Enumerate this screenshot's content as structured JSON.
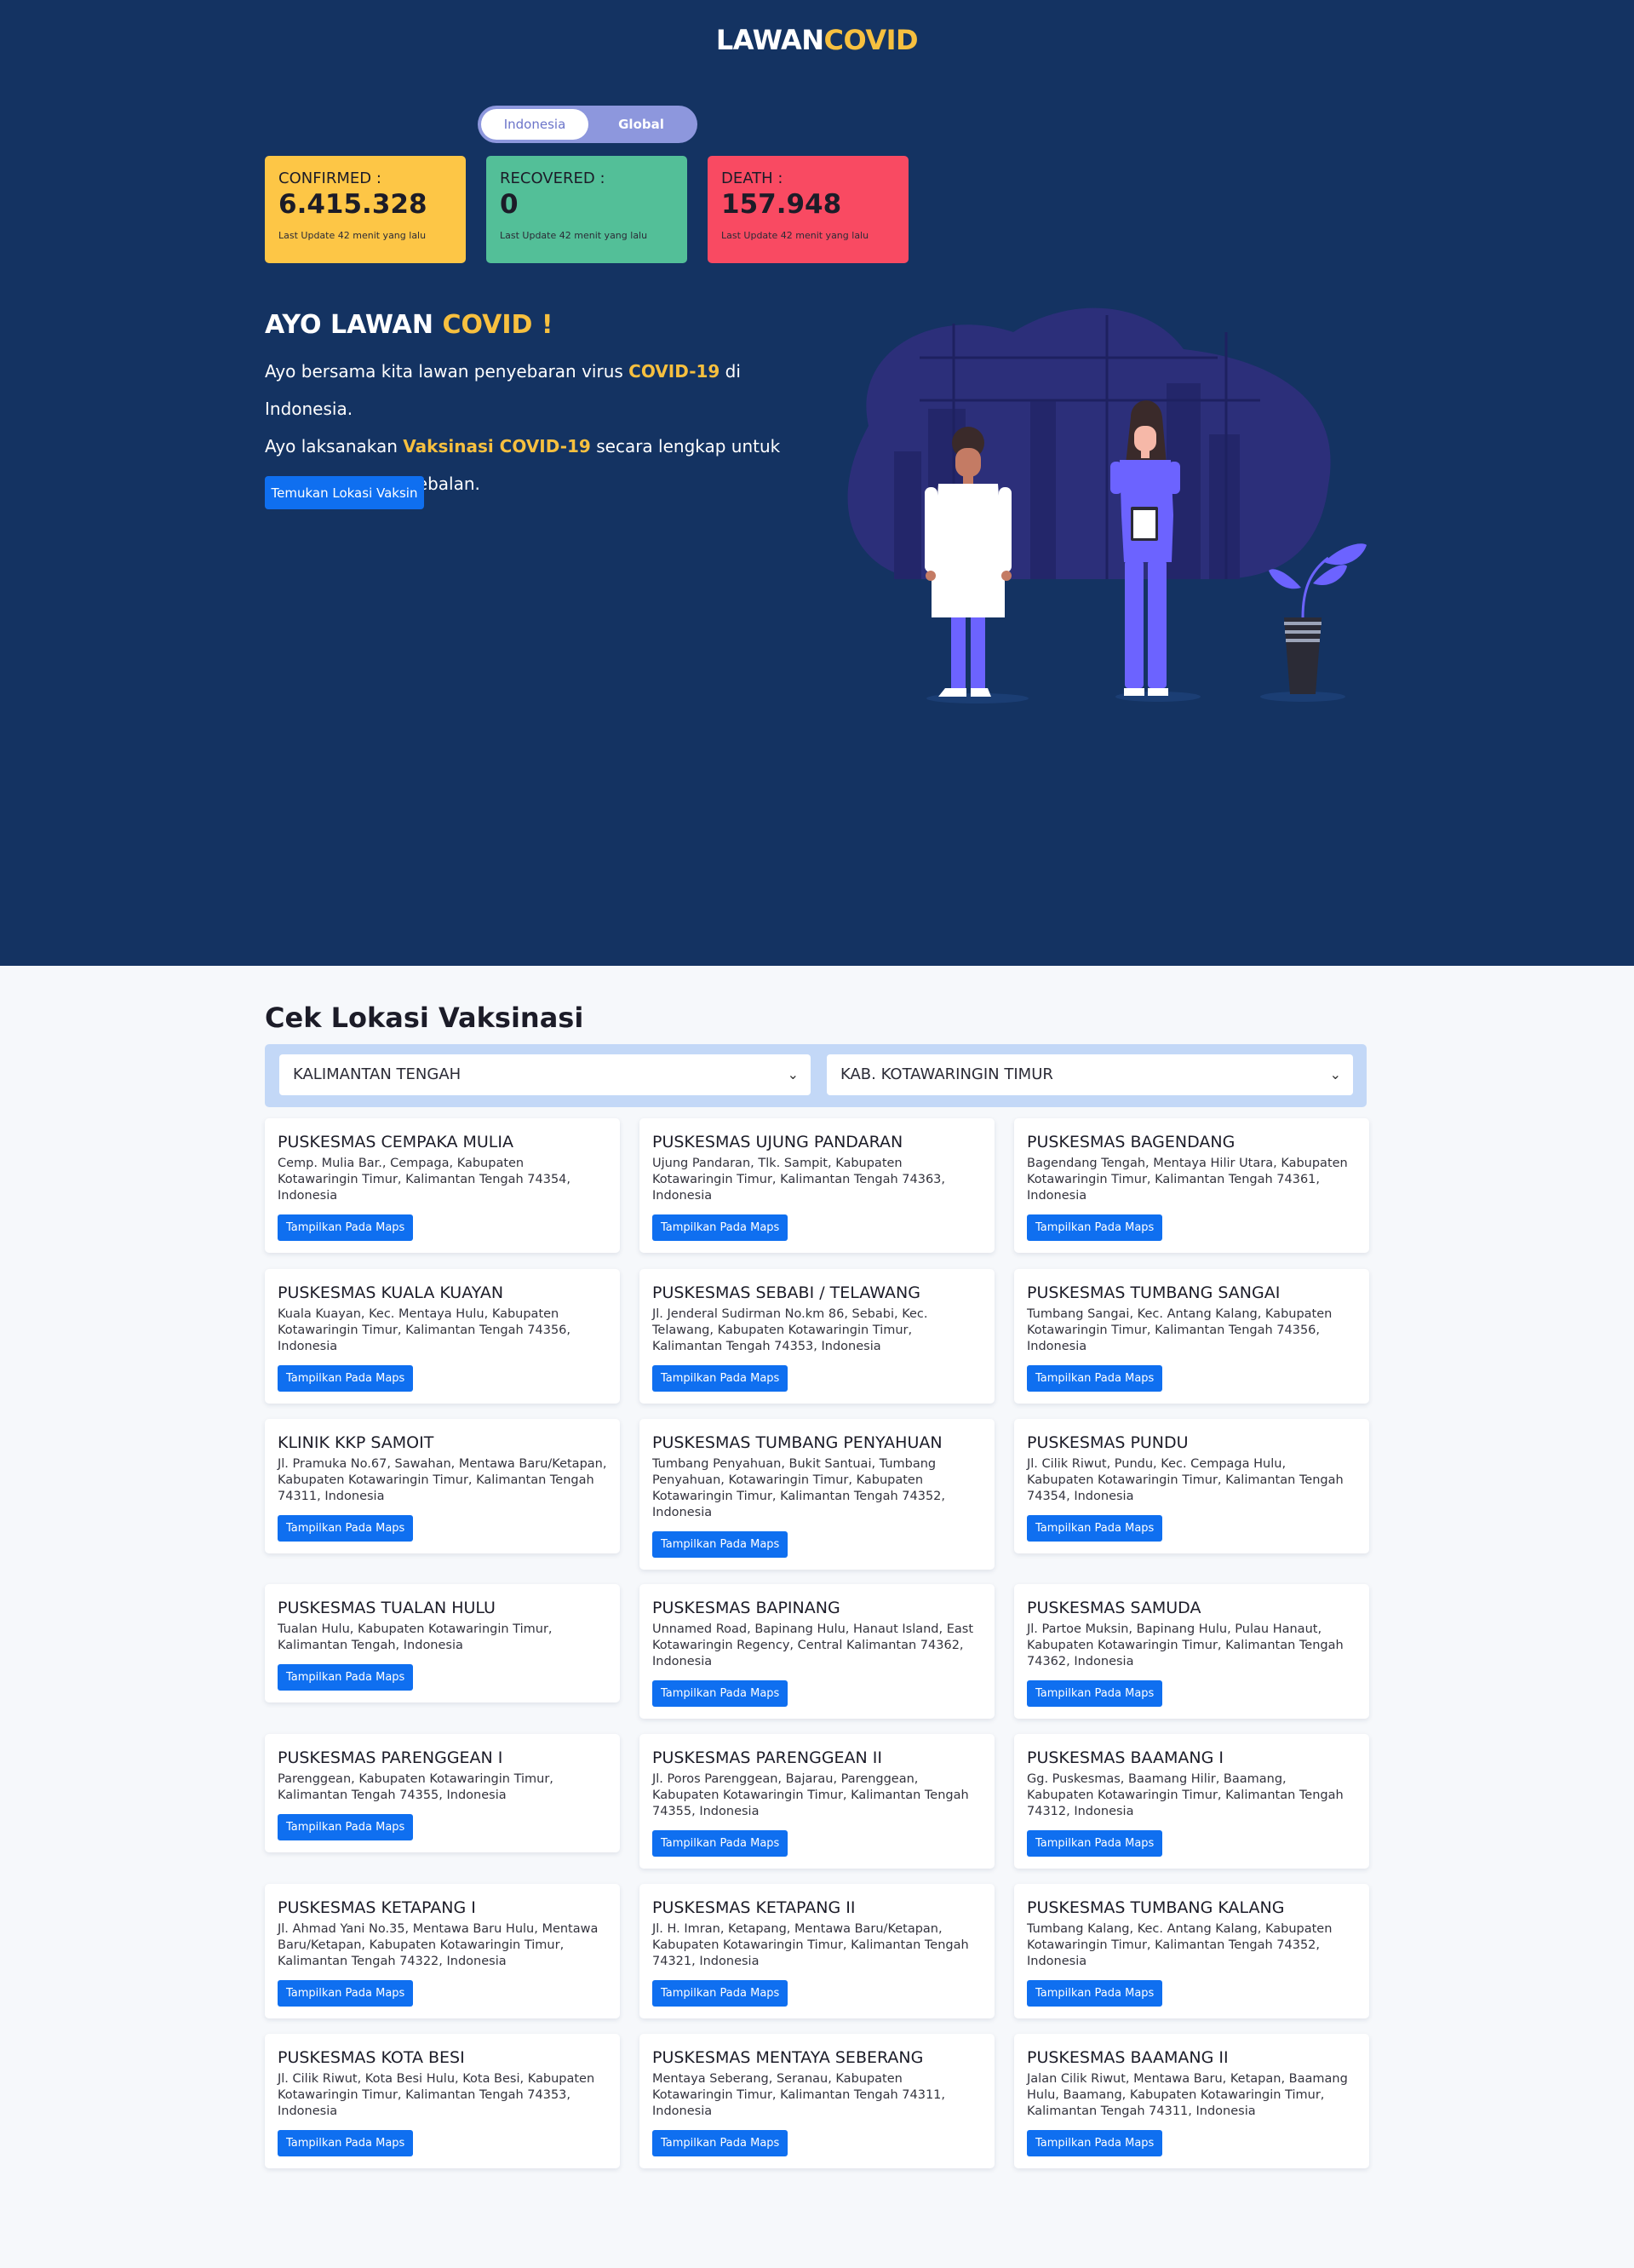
{
  "brand": {
    "part1": "LAWAN",
    "part2": "COVID"
  },
  "toggle": {
    "option_active": "Indonesia",
    "option_inactive": "Global"
  },
  "stats": {
    "confirmed": {
      "label": "CONFIRMED :",
      "value": "6.415.328",
      "update": "Last Update 42 menit yang lalu"
    },
    "recovered": {
      "label": "RECOVERED :",
      "value": "0",
      "update": "Last Update 42 menit yang lalu"
    },
    "death": {
      "label": "DEATH :",
      "value": "157.948",
      "update": "Last Update 42 menit yang lalu"
    }
  },
  "hero": {
    "headline_a": "AYO LAWAN ",
    "headline_b": "COVID !",
    "line1_a": "Ayo bersama kita lawan penyebaran virus ",
    "line1_b": "COVID-19",
    "line1_c": " di Indonesia.",
    "line2_a": "Ayo laksanakan ",
    "line2_b": "Vaksinasi COVID-19",
    "line2_c": " secara lengkap untuk mendapatkan kekebalan.",
    "cta_label": "Temukan Lokasi Vaksin"
  },
  "locations": {
    "title": "Cek Lokasi Vaksinasi",
    "province": "KALIMANTAN TENGAH",
    "regency": "KAB. KOTAWARINGIN TIMUR",
    "button_label": "Tampilkan Pada Maps",
    "items": [
      {
        "name": "PUSKESMAS CEMPAKA MULIA",
        "address": "Cemp. Mulia Bar., Cempaga, Kabupaten Kotawaringin Timur, Kalimantan Tengah 74354, Indonesia"
      },
      {
        "name": "PUSKESMAS UJUNG PANDARAN",
        "address": "Ujung Pandaran, Tlk. Sampit, Kabupaten Kotawaringin Timur, Kalimantan Tengah 74363, Indonesia"
      },
      {
        "name": "PUSKESMAS BAGENDANG",
        "address": "Bagendang Tengah, Mentaya Hilir Utara, Kabupaten Kotawaringin Timur, Kalimantan Tengah 74361, Indonesia"
      },
      {
        "name": "PUSKESMAS KUALA KUAYAN",
        "address": "Kuala Kuayan, Kec. Mentaya Hulu, Kabupaten Kotawaringin Timur, Kalimantan Tengah 74356, Indonesia"
      },
      {
        "name": "PUSKESMAS SEBABI / TELAWANG",
        "address": "Jl. Jenderal Sudirman No.km 86, Sebabi, Kec. Telawang, Kabupaten Kotawaringin Timur, Kalimantan Tengah 74353, Indonesia"
      },
      {
        "name": "PUSKESMAS TUMBANG SANGAI",
        "address": "Tumbang Sangai, Kec. Antang Kalang, Kabupaten Kotawaringin Timur, Kalimantan Tengah 74356, Indonesia"
      },
      {
        "name": "KLINIK KKP SAMOIT",
        "address": "Jl. Pramuka No.67, Sawahan, Mentawa Baru/Ketapan, Kabupaten Kotawaringin Timur, Kalimantan Tengah 74311, Indonesia"
      },
      {
        "name": "PUSKESMAS TUMBANG PENYAHUAN",
        "address": "Tumbang Penyahuan, Bukit Santuai, Tumbang Penyahuan, Kotawaringin Timur, Kabupaten Kotawaringin Timur, Kalimantan Tengah 74352, Indonesia"
      },
      {
        "name": "PUSKESMAS PUNDU",
        "address": "Jl. Cilik Riwut, Pundu, Kec. Cempaga Hulu, Kabupaten Kotawaringin Timur, Kalimantan Tengah 74354, Indonesia"
      },
      {
        "name": "PUSKESMAS TUALAN HULU",
        "address": "Tualan Hulu, Kabupaten Kotawaringin Timur, Kalimantan Tengah, Indonesia"
      },
      {
        "name": "PUSKESMAS BAPINANG",
        "address": "Unnamed Road, Bapinang Hulu, Hanaut Island, East Kotawaringin Regency, Central Kalimantan 74362, Indonesia"
      },
      {
        "name": "PUSKESMAS SAMUDA",
        "address": "Jl. Partoe Muksin, Bapinang Hulu, Pulau Hanaut, Kabupaten Kotawaringin Timur, Kalimantan Tengah 74362, Indonesia"
      },
      {
        "name": "PUSKESMAS PARENGGEAN I",
        "address": "Parenggean, Kabupaten Kotawaringin Timur, Kalimantan Tengah 74355, Indonesia"
      },
      {
        "name": "PUSKESMAS PARENGGEAN II",
        "address": "Jl. Poros Parenggean, Bajarau, Parenggean, Kabupaten Kotawaringin Timur, Kalimantan Tengah 74355, Indonesia"
      },
      {
        "name": "PUSKESMAS BAAMANG I",
        "address": "Gg. Puskesmas, Baamang Hilir, Baamang, Kabupaten Kotawaringin Timur, Kalimantan Tengah 74312, Indonesia"
      },
      {
        "name": "PUSKESMAS KETAPANG I",
        "address": "Jl. Ahmad Yani No.35, Mentawa Baru Hulu, Mentawa Baru/Ketapan, Kabupaten Kotawaringin Timur, Kalimantan Tengah 74322, Indonesia"
      },
      {
        "name": "PUSKESMAS KETAPANG II",
        "address": "Jl. H. Imran, Ketapang, Mentawa Baru/Ketapan, Kabupaten Kotawaringin Timur, Kalimantan Tengah 74321, Indonesia"
      },
      {
        "name": "PUSKESMAS TUMBANG KALANG",
        "address": "Tumbang Kalang, Kec. Antang Kalang, Kabupaten Kotawaringin Timur, Kalimantan Tengah 74352, Indonesia"
      },
      {
        "name": "PUSKESMAS KOTA BESI",
        "address": "Jl. Cilik Riwut, Kota Besi Hulu, Kota Besi, Kabupaten Kotawaringin Timur, Kalimantan Tengah 74353, Indonesia"
      },
      {
        "name": "PUSKESMAS MENTAYA SEBERANG",
        "address": "Mentaya Seberang, Seranau, Kabupaten Kotawaringin Timur, Kalimantan Tengah 74311, Indonesia"
      },
      {
        "name": "PUSKESMAS BAAMANG II",
        "address": "Jalan Cilik Riwut, Mentawa Baru, Ketapan, Baamang Hulu, Baamang, Kabupaten Kotawaringin Timur, Kalimantan Tengah 74311, Indonesia"
      }
    ]
  },
  "icons": {
    "select_arrow": "chevron-down-icon"
  },
  "colors": {
    "navy": "#143362",
    "accent_yellow": "#f7c03f",
    "confirmed": "#fdc646",
    "recovered": "#53bf98",
    "death": "#f94a62",
    "primary_button": "#0f6ff0",
    "purple": "#6c63ff"
  }
}
